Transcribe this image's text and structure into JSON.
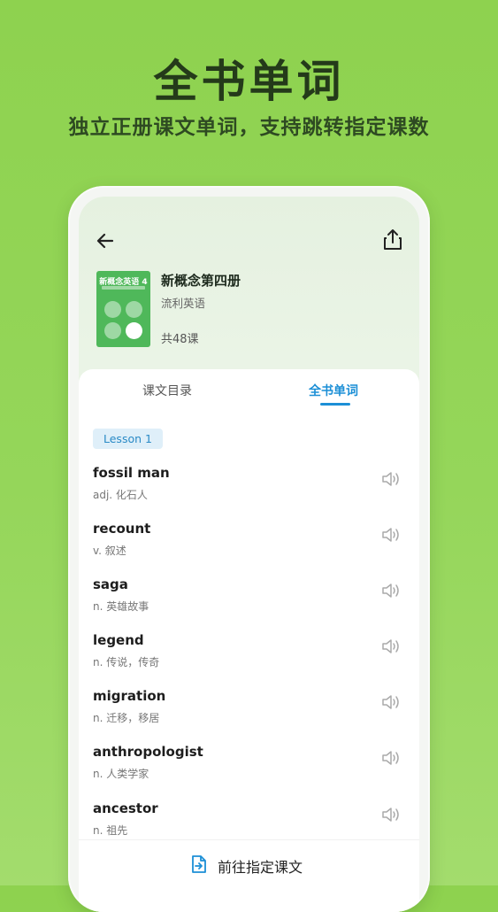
{
  "header": {
    "title": "全书单词",
    "subtitle": "独立正册课文单词，支持跳转指定课数"
  },
  "book": {
    "cover_title": "新概念英语 4",
    "title": "新概念第四册",
    "subtitle": "流利英语",
    "lesson_count": "共48课"
  },
  "tabs": [
    {
      "label": "课文目录",
      "active": false
    },
    {
      "label": "全书单词",
      "active": true
    }
  ],
  "lesson_label": "Lesson 1",
  "words": [
    {
      "word": "fossil man",
      "meaning": "adj. 化石人"
    },
    {
      "word": "recount",
      "meaning": "v. 叙述"
    },
    {
      "word": "saga",
      "meaning": "n. 英雄故事"
    },
    {
      "word": "legend",
      "meaning": "n. 传说，传奇"
    },
    {
      "word": "migration",
      "meaning": "n. 迁移，移居"
    },
    {
      "word": "anthropologist",
      "meaning": "n. 人类学家"
    },
    {
      "word": "ancestor",
      "meaning": "n. 祖先"
    }
  ],
  "bottom_action": {
    "label": "前往指定课文"
  },
  "icons": {
    "back": "back-arrow-icon",
    "share": "share-icon",
    "speaker": "speaker-icon",
    "goto": "goto-lesson-icon"
  },
  "colors": {
    "background": "#8ed24f",
    "accent": "#1c8fd6",
    "cover": "#4fb85a",
    "badge_bg": "#dfeff9"
  }
}
